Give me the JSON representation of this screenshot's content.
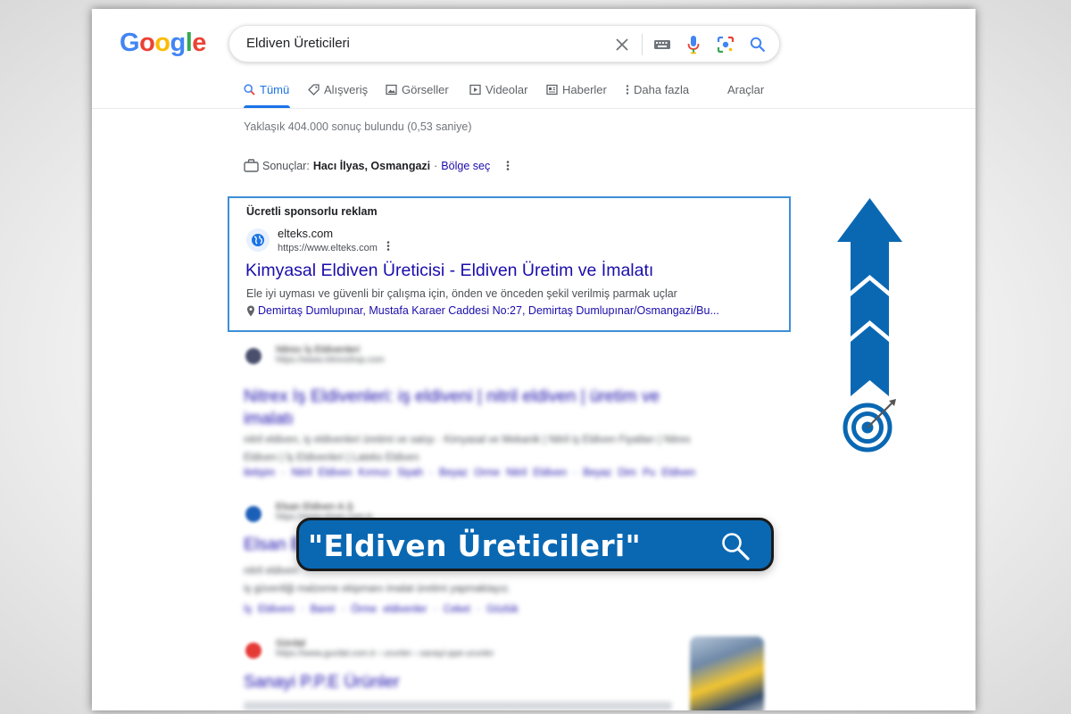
{
  "search": {
    "query": "Eldiven Üreticileri"
  },
  "logo": {
    "letters": [
      "G",
      "o",
      "o",
      "g",
      "l",
      "e"
    ]
  },
  "tabs": [
    {
      "label": "Tümü"
    },
    {
      "label": "Alışveriş"
    },
    {
      "label": "Görseller"
    },
    {
      "label": "Videolar"
    },
    {
      "label": "Haberler"
    },
    {
      "label": "Daha fazla"
    },
    {
      "label": "Araçlar"
    }
  ],
  "stats": "Yaklaşık 404.000 sonuç bulundu (0,53 saniye)",
  "location": {
    "prefix": "Sonuçlar:",
    "place": "Hacı İlyas, Osmangazi",
    "sep": "·",
    "link": "Bölge seç"
  },
  "ad": {
    "label": "Ücretli sponsorlu reklam",
    "site": "elteks.com",
    "url": "https://www.elteks.com",
    "title": "Kimyasal Eldiven Üreticisi - Eldiven Üretim ve İmalatı",
    "description": "Ele iyi uyması ve güvenli bir çalışma için, önden ve önceden şekil verilmiş parmak uçlar",
    "address": "Demirtaş Dumlupınar, Mustafa Karaer Caddesi No:27, Demirtaş Dumlupınar/Osmangazi/Bu..."
  },
  "blurred_results": [
    {
      "site": "Nitrex İş Eldivenleri",
      "url": "https://www.nitrexshop.com",
      "title_line1": "Nitrex İş Eldivenleri: iş eldiveni | nitril eldiven | üretim ve",
      "title_line2": "imalatı",
      "text_line1": "nitril eldiven, iş eldivenleri üretimi ve satışı · Kimyasal ve Mekanik | Nitril iş Eldiven Fiyatları | Nitrex",
      "text_line2": "Eldiven | İş Eldivenleri | Lateks Eldiven",
      "links": "iletişim · Nitril Eldiven Kırmızı Siyah · Beyaz Örme Nitril Eldiven · Beyaz Dim Pu Eldiven"
    },
    {
      "site": "Elsan Eldiven A.Ş",
      "url": "https://www.elsan.com.tr",
      "title": "Elsan Eldiven",
      "text_line1": "nitril eldiven",
      "text_line2": "iş güvenliği malzeme ekipmanı imalat üretimi yapmaktayız.",
      "links": "İş Eldiveni · Baret · Örme eldivenler · Ceket · Gözlük"
    },
    {
      "site": "Gürdal",
      "url": "https://www.gurdal.com.tr › urunler › sanayi-ppe-urunler",
      "title": "Sanayi P.P.E Ürünler"
    }
  ],
  "overlay": {
    "query_display": "\"Eldiven Üreticileri\""
  },
  "colors": {
    "accent": "#1a73e8",
    "link": "#1a0dab",
    "overlay_blue": "#0a68b3",
    "ad_border": "#3d8fd6"
  }
}
